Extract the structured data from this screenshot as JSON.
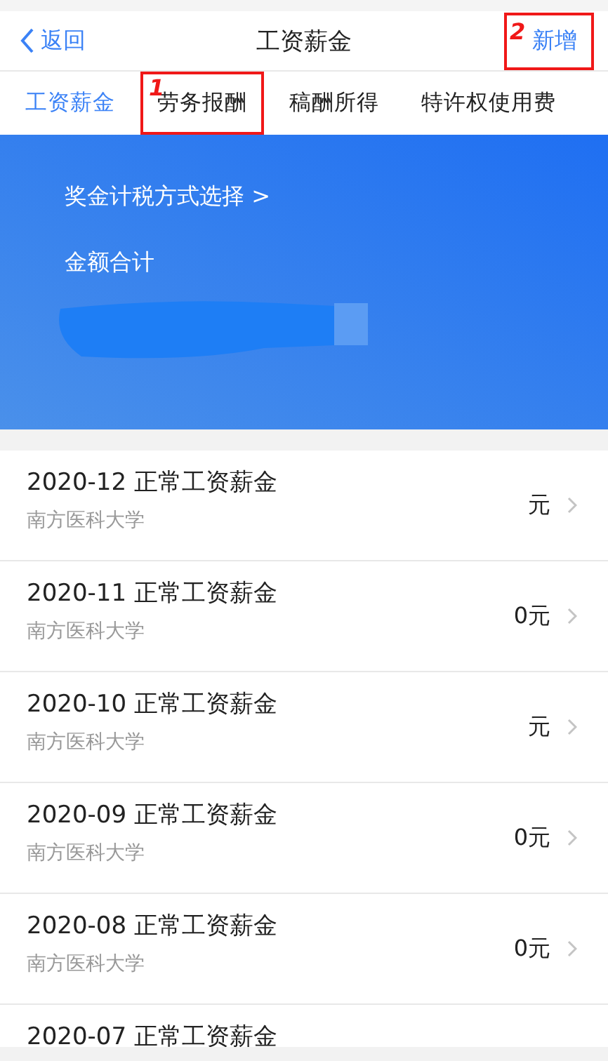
{
  "nav": {
    "back": "返回",
    "title": "工资薪金",
    "action": {
      "label": "新增",
      "annotation": "2"
    }
  },
  "tabs": [
    {
      "label": "工资薪金",
      "selected": true
    },
    {
      "label": "劳务报酬",
      "selected": false,
      "annotation": "1"
    },
    {
      "label": "稿酬所得",
      "selected": false
    },
    {
      "label": "特许权使用费",
      "selected": false
    }
  ],
  "summary": {
    "link": "奖金计税方式选择 >",
    "total_label": "金额合计"
  },
  "records": [
    {
      "title": "2020-12 正常工资薪金",
      "org": "南方医科大学",
      "amount": "元"
    },
    {
      "title": "2020-11 正常工资薪金",
      "org": "南方医科大学",
      "amount": "0元"
    },
    {
      "title": "2020-10 正常工资薪金",
      "org": "南方医科大学",
      "amount": "元"
    },
    {
      "title": "2020-09 正常工资薪金",
      "org": "南方医科大学",
      "amount": "0元"
    },
    {
      "title": "2020-08 正常工资薪金",
      "org": "南方医科大学",
      "amount": "0元"
    },
    {
      "title": "2020-07 正常工资薪金"
    }
  ]
}
